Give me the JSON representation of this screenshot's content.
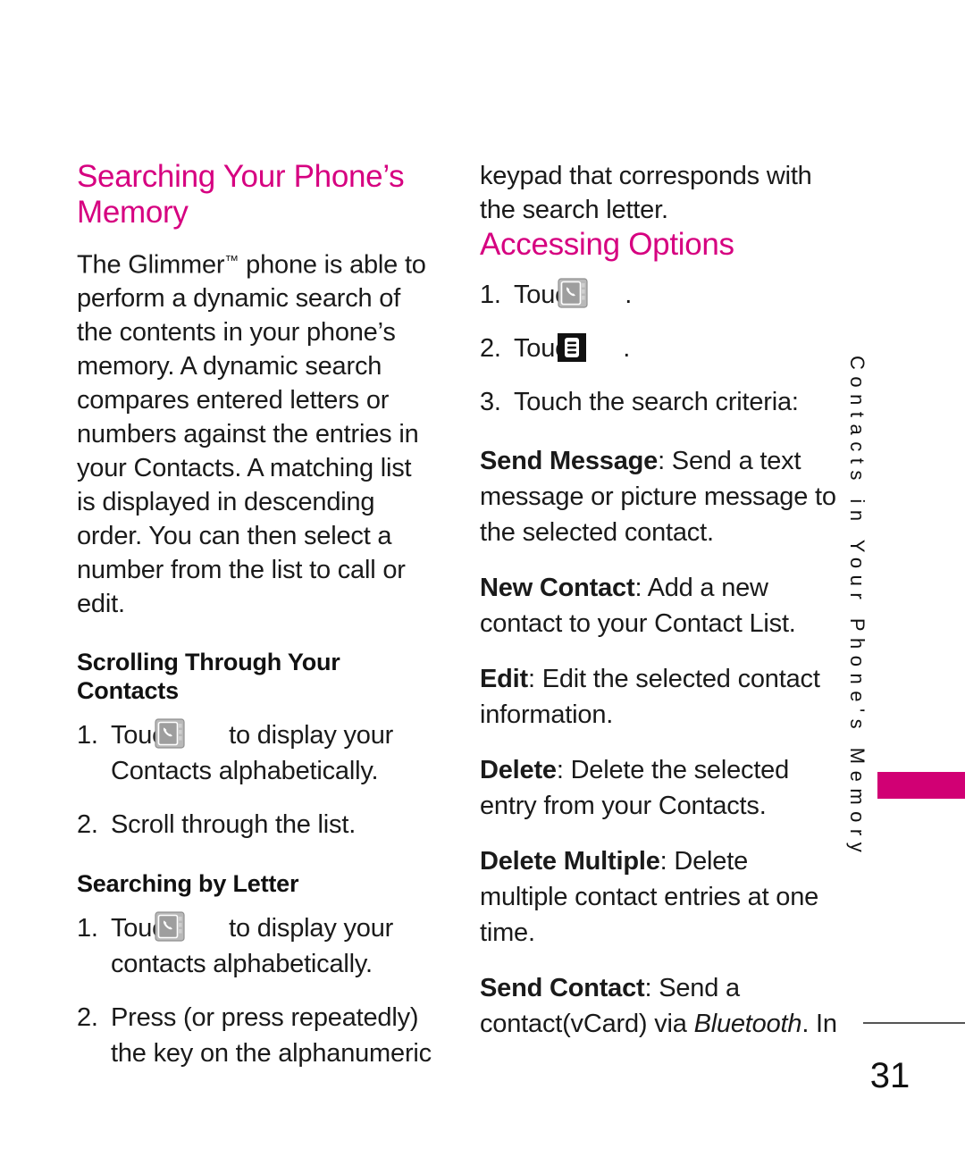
{
  "document": {
    "page_number": "31",
    "side_tab_label": "Contacts in Your Phone's Memory",
    "accent_color": "#D60080",
    "tab_color": "#D10074"
  },
  "left_column": {
    "heading": "Searching Your Phone’s Memory",
    "intro_before_tm": "The Glimmer",
    "intro_tm": "™",
    "intro_after_tm": " phone is able to perform a dynamic search of the contents in your phone’s memory. A dynamic search compares entered letters or numbers against the entries in your Contacts. A matching list is displayed in descending order. You can then select a number from the list to call or edit.",
    "subheading_scrolling": "Scrolling Through Your Contacts",
    "scrolling_steps": [
      {
        "num": "1.",
        "text_before_icon": "Touch ",
        "icon": "contacts-book-icon",
        "text_after_icon": " to display your Contacts alphabetically."
      },
      {
        "num": "2.",
        "text_before_icon": "Scroll through the list.",
        "icon": "",
        "text_after_icon": ""
      }
    ],
    "subheading_searching": "Searching by Letter",
    "searching_steps": [
      {
        "num": "1.",
        "text_before_icon": "Touch ",
        "icon": "contacts-book-icon",
        "text_after_icon": " to display your contacts alphabetically."
      },
      {
        "num": "2.",
        "text_before_icon": "Press (or press repeatedly) the key on the alphanumeric",
        "icon": "",
        "text_after_icon": ""
      }
    ]
  },
  "right_column": {
    "continued_text": "keypad that corresponds with the search letter.",
    "heading": "Accessing Options",
    "steps": [
      {
        "num": "1.",
        "text_before_icon": "Touch ",
        "icon": "contacts-book-icon",
        "text_after_icon": "."
      },
      {
        "num": "2.",
        "text_before_icon": "Touch ",
        "icon": "menu-options-icon",
        "text_after_icon": "."
      },
      {
        "num": "3.",
        "text_before_icon": "Touch the search criteria:",
        "icon": "",
        "text_after_icon": ""
      }
    ],
    "options": [
      {
        "term": "Send Message",
        "sep": ": ",
        "desc": "Send a text message or picture message to the selected contact.",
        "italic": "",
        "desc_tail": ""
      },
      {
        "term": "New Contact",
        "sep": ": ",
        "desc": "Add a new contact to your Contact List.",
        "italic": "",
        "desc_tail": ""
      },
      {
        "term": "Edit",
        "sep": ": ",
        "desc": "Edit the selected contact information.",
        "italic": "",
        "desc_tail": ""
      },
      {
        "term": "Delete",
        "sep": ": ",
        "desc": "Delete the selected entry from your Contacts.",
        "italic": "",
        "desc_tail": ""
      },
      {
        "term": "Delete Multiple",
        "sep": ": ",
        "desc": "Delete multiple contact entries at one time.",
        "italic": "",
        "desc_tail": ""
      },
      {
        "term": "Send Contact",
        "sep": ": ",
        "desc": "Send a contact(vCard) via ",
        "italic": "Bluetooth",
        "desc_tail": ". In"
      }
    ]
  }
}
